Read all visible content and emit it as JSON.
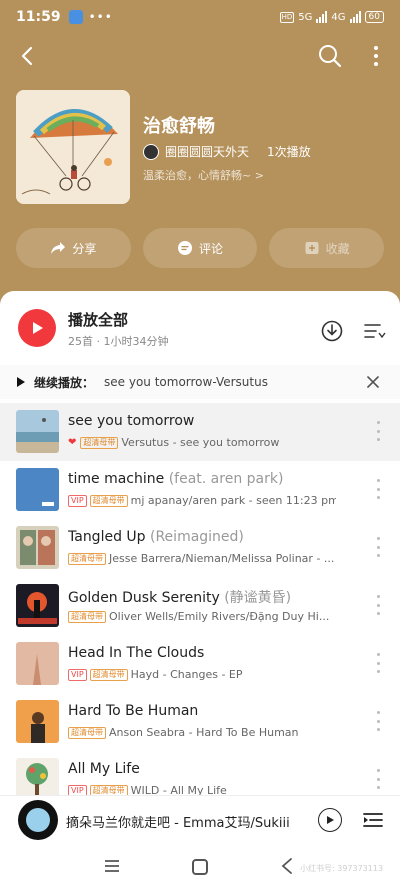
{
  "status": {
    "time": "11:59",
    "network1": "5G",
    "network2": "4G",
    "battery": "60",
    "hd": "HD"
  },
  "playlist": {
    "title": "治愈舒畅",
    "creator": "圈圈圆圆天外天",
    "plays": "1次播放",
    "desc": "温柔治愈，心情舒畅~ >"
  },
  "actions": {
    "share": "分享",
    "comment": "评论",
    "collect": "收藏"
  },
  "playall": {
    "title": "播放全部",
    "sub": "25首 · 1小时34分钟"
  },
  "resume": {
    "label": "继续播放：",
    "song": "see you tomorrow-Versutus"
  },
  "songs": [
    {
      "title": "see you tomorrow",
      "feat": "",
      "heart": true,
      "vip": false,
      "quality": "超清母带",
      "sub": "Versutus - see you tomorrow"
    },
    {
      "title": "time machine ",
      "feat": "(feat. aren park)",
      "heart": false,
      "vip": true,
      "quality": "超清母带",
      "sub": "mj apanay/aren park - seen 11:23 pm"
    },
    {
      "title": "Tangled Up ",
      "feat": "(Reimagined)",
      "heart": false,
      "vip": false,
      "quality": "超清母带",
      "sub": "Jesse Barrera/Nieman/Melissa Polinar - ..."
    },
    {
      "title": "Golden Dusk Serenity ",
      "feat": "(静谧黄昏)",
      "heart": false,
      "vip": false,
      "quality": "超清母带",
      "sub": "Oliver Wells/Emily Rivers/Đặng Duy Hi..."
    },
    {
      "title": "Head In The Clouds",
      "feat": "",
      "heart": false,
      "vip": true,
      "quality": "超清母带",
      "sub": "Hayd - Changes - EP"
    },
    {
      "title": "Hard To Be Human",
      "feat": "",
      "heart": false,
      "vip": false,
      "quality": "超清母带",
      "sub": "Anson Seabra - Hard To Be Human"
    },
    {
      "title": "All My Life",
      "feat": "",
      "heart": false,
      "vip": true,
      "quality": "超清母带",
      "sub": "WILD - All My Life"
    }
  ],
  "badges": {
    "vip": "VIP"
  },
  "mini_player": {
    "title": "摘朵马兰你就走吧 - Emma艾玛/Sukiii"
  },
  "watermark": "小红书号: 397373113",
  "colors": {
    "header_bg": "#b5915b",
    "accent": "#f0383d"
  }
}
